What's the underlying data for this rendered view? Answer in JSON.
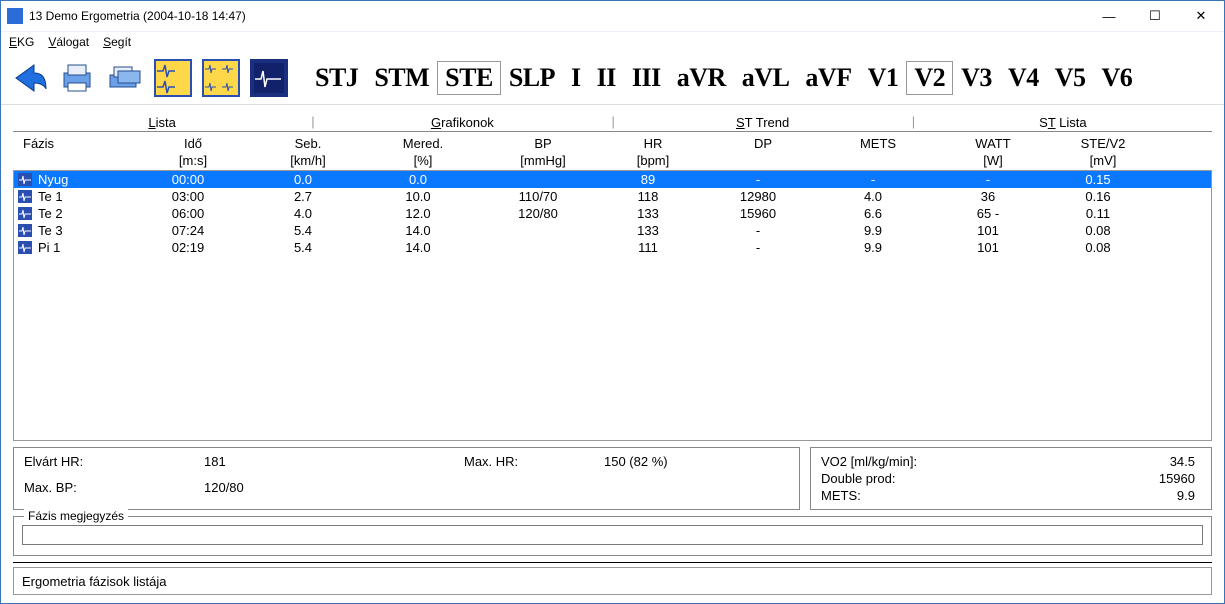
{
  "titlebar": {
    "title": "13 Demo Ergometria (2004-10-18 14:47)"
  },
  "menu": {
    "ekg": "EKG",
    "valogat": "Válogat",
    "segit": "Segít"
  },
  "tabs": {
    "param_tabs": [
      "STJ",
      "STM",
      "STE",
      "SLP",
      "I",
      "II",
      "III",
      "aVR",
      "aVL",
      "aVF",
      "V1",
      "V2",
      "V3",
      "V4",
      "V5",
      "V6"
    ],
    "param_sel": "STE",
    "lead_sel": "V2",
    "views": [
      {
        "l": "Lista",
        "u": "L"
      },
      {
        "l": "Grafikonok",
        "u": "G"
      },
      {
        "l": "ST Trend",
        "u": "S"
      },
      {
        "l": "ST Lista",
        "u": "T"
      }
    ]
  },
  "headers": {
    "fazis": "Fázis",
    "ido": "Idő",
    "ido_u": "[m:s]",
    "seb": "Seb.",
    "seb_u": "[km/h]",
    "mered": "Mered.",
    "mered_u": "[%]",
    "bp": "BP",
    "bp_u": "[mmHg]",
    "hr": "HR",
    "hr_u": "[bpm]",
    "dp": "DP",
    "mets": "METS",
    "watt": "WATT",
    "watt_u": "[W]",
    "ste": "STE/V2",
    "ste_u": "[mV]"
  },
  "rows": [
    {
      "ph": "Nyug",
      "ido": "00:00",
      "seb": "0.0",
      "mer": "0.0",
      "bp": "",
      "hr": "89",
      "dp": "-",
      "mets": "-",
      "watt": "-",
      "ste": "0.15",
      "sel": true
    },
    {
      "ph": "Te 1",
      "ido": "03:00",
      "seb": "2.7",
      "mer": "10.0",
      "bp": "110/70",
      "hr": "118",
      "dp": "12980",
      "mets": "4.0",
      "watt": "36",
      "ste": "0.16"
    },
    {
      "ph": "Te 2",
      "ido": "06:00",
      "seb": "4.0",
      "mer": "12.0",
      "bp": "120/80",
      "hr": "133",
      "dp": "15960",
      "mets": "6.6",
      "watt": "65 -",
      "ste": "0.11"
    },
    {
      "ph": "Te 3",
      "ido": "07:24",
      "seb": "5.4",
      "mer": "14.0",
      "bp": "",
      "hr": "133",
      "dp": "-",
      "mets": "9.9",
      "watt": "101",
      "ste": "0.08"
    },
    {
      "ph": "Pi 1",
      "ido": "02:19",
      "seb": "5.4",
      "mer": "14.0",
      "bp": "",
      "hr": "111",
      "dp": "-",
      "mets": "9.9",
      "watt": "101",
      "ste": "0.08"
    }
  ],
  "stats_left": {
    "elvart_hr_l": "Elvárt HR:",
    "elvart_hr_v": "181",
    "max_hr_l": "Max. HR:",
    "max_hr_v": "150 (82 %)",
    "max_bp_l": "Max. BP:",
    "max_bp_v": "120/80"
  },
  "stats_right": {
    "vo2_l": "VO2 [ml/kg/min]:",
    "vo2_v": "34.5",
    "dp_l": "Double prod:",
    "dp_v": "15960",
    "mets_l": "METS:",
    "mets_v": "9.9"
  },
  "fazis_legend": "Fázis megjegyzés",
  "statusbar": "Ergometria fázisok listája"
}
